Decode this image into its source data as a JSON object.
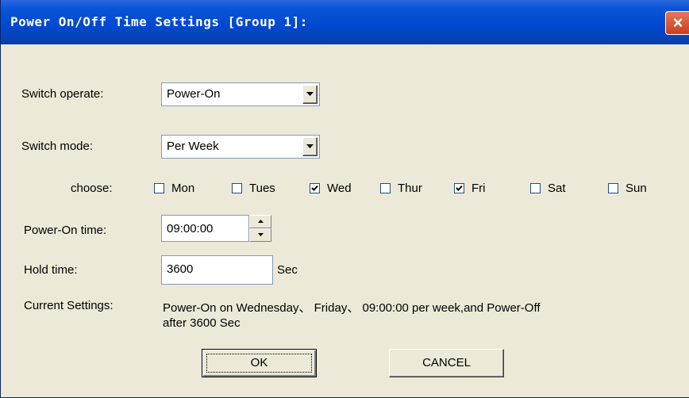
{
  "window": {
    "title": "Power On/Off Time Settings [Group 1]:",
    "close_glyph": "×"
  },
  "switch_operate": {
    "label": "Switch operate:",
    "selected": "Power-On"
  },
  "switch_mode": {
    "label": "Switch  mode:",
    "selected": "Per Week"
  },
  "choose": {
    "label": "choose:",
    "days": [
      {
        "label": "Mon",
        "checked": false
      },
      {
        "label": "Tues",
        "checked": false
      },
      {
        "label": "Wed",
        "checked": true
      },
      {
        "label": "Thur",
        "checked": false
      },
      {
        "label": "Fri",
        "checked": true
      },
      {
        "label": "Sat",
        "checked": false
      },
      {
        "label": "Sun",
        "checked": false
      }
    ]
  },
  "power_on_time": {
    "label": "Power-On time:",
    "value": "09:00:00"
  },
  "hold_time": {
    "label": "Hold time:",
    "value": "3600",
    "unit": "Sec"
  },
  "current_settings": {
    "label": "Current Settings:",
    "line1": "Power-On on Wednesday、 Friday、 09:00:00 per week,and Power-Off",
    "line2": "after 3600 Sec"
  },
  "buttons": {
    "ok": "OK",
    "cancel": "CANCEL"
  },
  "icons": {
    "close": "close-icon",
    "dropdown": "dropdown-arrow-icon",
    "check": "checkmark-icon",
    "spin_up": "spin-up-icon",
    "spin_down": "spin-down-icon"
  }
}
